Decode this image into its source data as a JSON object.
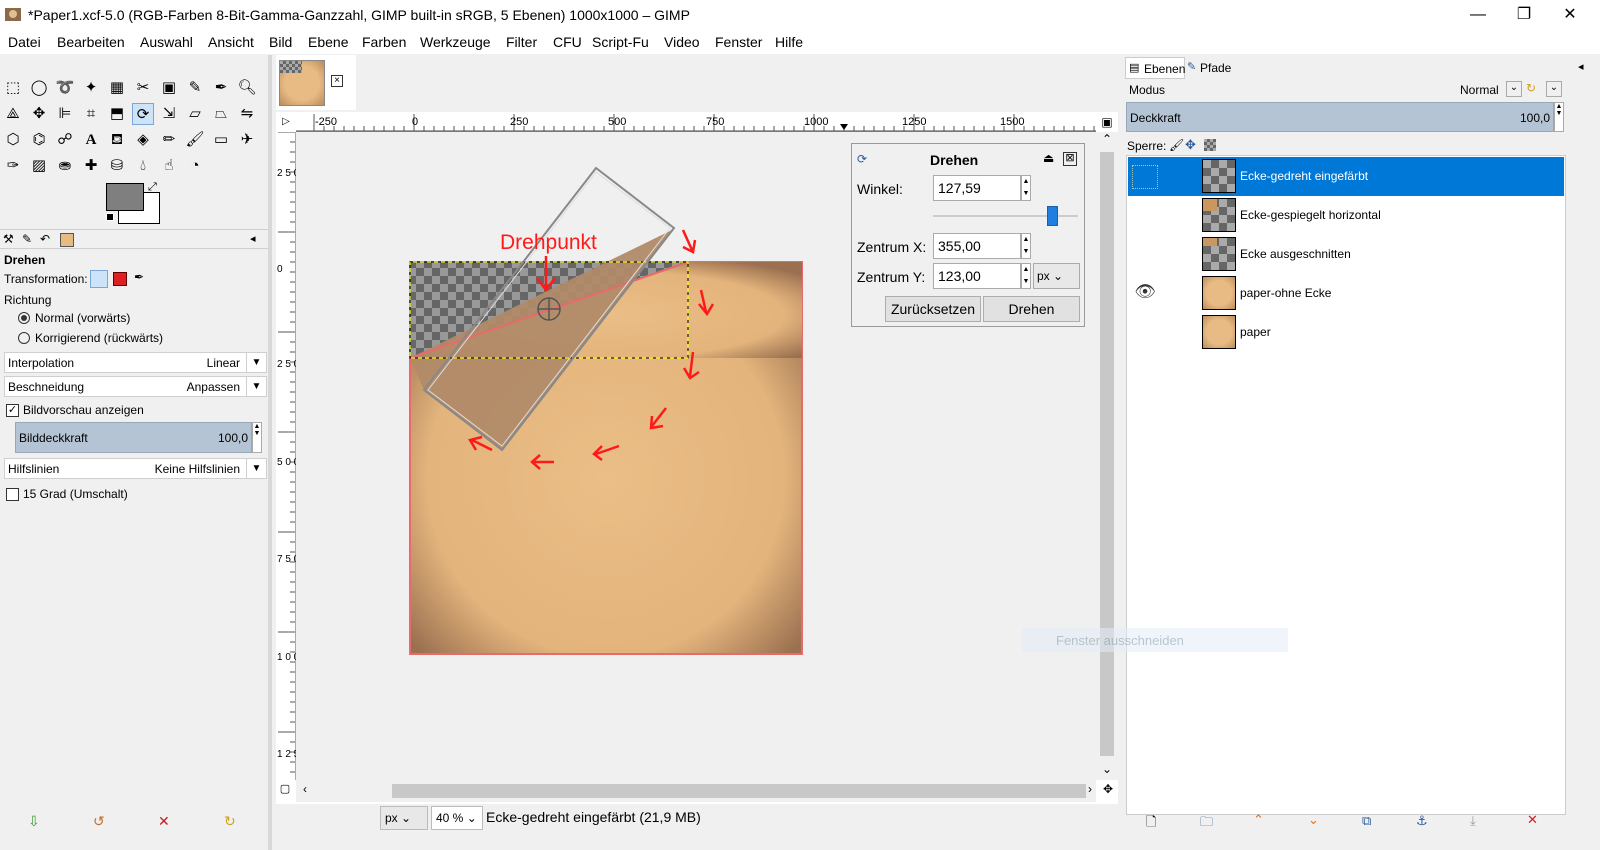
{
  "window": {
    "title": "*Paper1.xcf-5.0 (RGB-Farben 8-Bit-Gamma-Ganzzahl, GIMP built-in sRGB, 5 Ebenen) 1000x1000 – GIMP",
    "minimize": "—",
    "restore": "❐",
    "close": "✕"
  },
  "menu": [
    "Datei",
    "Bearbeiten",
    "Auswahl",
    "Ansicht",
    "Bild",
    "Ebene",
    "Farben",
    "Werkzeuge",
    "Filter",
    "CFU",
    "Script-Fu",
    "Video",
    "Fenster",
    "Hilfe"
  ],
  "tool_options": {
    "title": "Drehen",
    "transformation_label": "Transformation:",
    "richtung_label": "Richtung",
    "dir_normal": "Normal (vorwärts)",
    "dir_corrective": "Korrigierend (rückwärts)",
    "interpolation_label": "Interpolation",
    "interpolation_value": "Linear",
    "clipping_label": "Beschneidung",
    "clipping_value": "Anpassen",
    "preview_label": "Bildvorschau anzeigen",
    "opacity_label": "Bilddeckkraft",
    "opacity_value": "100,0",
    "guides_label": "Hilfslinien",
    "guides_value": "Keine Hilfslinien",
    "grad15_label": "15 Grad (Umschalt)"
  },
  "ruler_top": [
    "-250",
    "0",
    "250",
    "500",
    "750",
    "1000",
    "1250",
    "1500"
  ],
  "ruler_left": [
    "2 5 0",
    "0",
    "2 5 0",
    "5 0 0",
    "7 5 0",
    "1 0 0 0",
    "1 2 5 0"
  ],
  "canvas": {
    "annotation": "Drehpunkt"
  },
  "rotate_dialog": {
    "title": "Drehen",
    "angle_label": "Winkel:",
    "angle_value": "127,59",
    "angle_slider": 0.85,
    "center_x_label": "Zentrum X:",
    "center_x_value": "355,00",
    "center_y_label": "Zentrum Y:",
    "center_y_value": "123,00",
    "unit": "px",
    "reset_button": "Zurücksetzen",
    "rotate_button": "Drehen"
  },
  "status": {
    "unit": "px",
    "zoom": "40 %",
    "message": "Ecke-gedreht eingefärbt (21,9 MB)"
  },
  "layers_panel": {
    "tab_layers": "Ebenen",
    "tab_paths": "Pfade",
    "mode_label": "Modus",
    "mode_value": "Normal",
    "opacity_label": "Deckkraft",
    "opacity_value": "100,0",
    "lock_label": "Sperre:",
    "layers": [
      {
        "name": "Ecke-gedreht eingefärbt",
        "visible": false,
        "selected": true,
        "thumb": "checker"
      },
      {
        "name": "Ecke-gespiegelt horizontal",
        "visible": false,
        "selected": false,
        "thumb": "checker"
      },
      {
        "name": "Ecke ausgeschnitten",
        "visible": false,
        "selected": false,
        "thumb": "checker"
      },
      {
        "name": "paper-ohne Ecke",
        "visible": true,
        "selected": false,
        "thumb": "paper"
      },
      {
        "name": "paper",
        "visible": false,
        "selected": false,
        "thumb": "paper"
      }
    ],
    "ghost_tooltip": "Fenster ausschneiden"
  },
  "colors": {
    "selection_blue": "#0078d7",
    "annotation_red": "#ff0000",
    "paper": "#e8bb85"
  }
}
